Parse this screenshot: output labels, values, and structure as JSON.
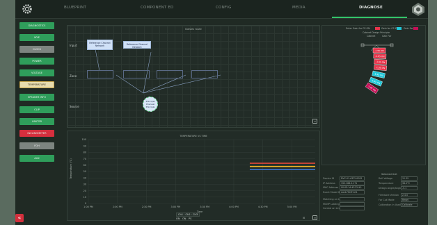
{
  "nav": {
    "tabs": [
      {
        "label": "BLUEPRINT"
      },
      {
        "label": "COMPONENT ED"
      },
      {
        "label": "CONFIG"
      },
      {
        "label": "MEDIA"
      },
      {
        "label": "DIAGNOSE"
      }
    ],
    "active_index": 4,
    "accent": "#34c46a"
  },
  "sidebar": {
    "items": [
      {
        "label": "DIAGNOSTICS",
        "style": "green"
      },
      {
        "label": "WYE",
        "style": "green"
      },
      {
        "label": "CLOCK",
        "style": "grey"
      },
      {
        "label": "POWER",
        "style": "green"
      },
      {
        "label": "VOLTAGE",
        "style": "green"
      },
      {
        "label": "TEMPERATURE",
        "style": "yellow"
      },
      {
        "label": "SPEAKER INFO",
        "style": "green"
      },
      {
        "label": "CLIP",
        "style": "green"
      },
      {
        "label": "LIMITER",
        "style": "green"
      },
      {
        "label": "INCLINOMETER",
        "style": "red"
      },
      {
        "label": "FOH",
        "style": "grey"
      },
      {
        "label": "AUX",
        "style": "green"
      }
    ]
  },
  "flow": {
    "title": "Daisies route",
    "rows": {
      "input": "Input",
      "zone": "Zone",
      "source": "Source"
    },
    "input_nodes": [
      "Reference Channel Network",
      "Reference Channel Network"
    ],
    "source_node": "Principal Channel Principle"
  },
  "chart": {
    "title": "TEMPERATURE VS TIME",
    "ylabel": "Temperature (°C)",
    "xlabel": "Time"
  },
  "chart_data": {
    "type": "line",
    "title": "TEMPERATURE VS TIME",
    "xlabel": "Time",
    "ylabel": "Temperature (°C)",
    "categories": [
      "1:00 PM",
      "2:00 PM",
      "2:30 PM",
      "3:00 PM",
      "3:30 PM",
      "4:00 PM",
      "4:30 PM",
      "5:00 PM"
    ],
    "ylim": [
      0,
      100
    ],
    "yticks": [
      0,
      10,
      20,
      30,
      40,
      50,
      60,
      70,
      80,
      90,
      100
    ],
    "x_range": [
      0,
      7.8
    ],
    "series": [
      {
        "name": "Ch1",
        "color": "#e0473a",
        "x": [
          5.55,
          7.8
        ],
        "values": [
          63,
          63
        ]
      },
      {
        "name": "Ch2",
        "color": "#f0b429",
        "x": [
          5.55,
          7.8
        ],
        "values": [
          58,
          58
        ]
      },
      {
        "name": "Ch3",
        "color": "#3a78d8",
        "x": [
          5.55,
          7.8
        ],
        "values": [
          53,
          53
        ]
      }
    ],
    "grid": true,
    "legend": "bottom"
  },
  "legend": {
    "top": [
      "Ch1",
      "Ch2",
      "Ch3"
    ],
    "bottom": [
      "ON",
      "ON",
      "PS"
    ]
  },
  "inclinometer": {
    "header_labels": [
      "Enter Gain for CS ON",
      "Gain for CS Z",
      "Gain For"
    ],
    "sub_labels": [
      "Cabinet Design Principle",
      "Cabinet",
      "Gain For"
    ],
    "elements": [
      "-1.95 ON",
      "-1.95 ON",
      "-1.95 ON",
      "-1.95 ON",
      "-1.95 ON",
      "-1.95 ON",
      "-1.95 ON"
    ],
    "colors": [
      "#e8344b",
      "#e8344b",
      "#e8344b",
      "#e8344b",
      "#20c7d8",
      "#20c7d8",
      "#c40f55"
    ]
  },
  "info_left": {
    "rows": [
      {
        "label": "Device ID",
        "value": "DVC-01-A3F2-0092"
      },
      {
        "label": "IP Address",
        "value": "192.168.0.171"
      },
      {
        "label": "MAC Address",
        "value": "00:0E:1A:4F:22:90"
      },
      {
        "label": "Event Model ID",
        "value": "LA-8-FRNT-001"
      },
      {
        "label": "Matching on Link",
        "value": ""
      },
      {
        "label": "MCMP Labling",
        "value": ""
      },
      {
        "label": "Control on Link",
        "value": ""
      }
    ]
  },
  "info_right": {
    "title": "Selected Unit",
    "rows": [
      {
        "label": "Rail Voltage",
        "value": "12.3V"
      },
      {
        "label": "Temperature",
        "value": "38.0°C"
      },
      {
        "label": "Design Angle/Angle",
        "value": "-5.1"
      },
      {
        "label": "Firmware Version",
        "value": "2.4.0"
      },
      {
        "label": "For Cut Mode",
        "value": "Reset"
      },
      {
        "label": "Calibration in Use/Mode",
        "value": "Calibrate"
      }
    ]
  }
}
